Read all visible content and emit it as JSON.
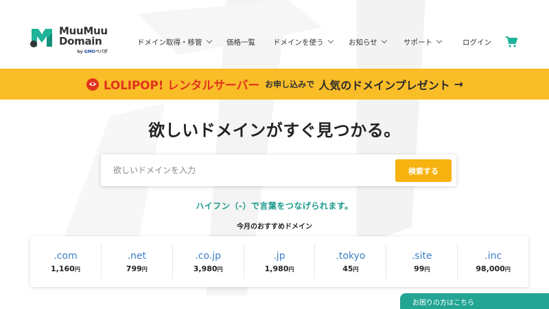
{
  "logo": {
    "line1": "MuuMuu",
    "line2": "Domain",
    "by_text": "by",
    "by_brand": "GMO",
    "by_suffix": "ペパボ"
  },
  "nav": {
    "items": [
      {
        "label": "ドメイン取得・移管",
        "has_dropdown": true
      },
      {
        "label": "価格一覧",
        "has_dropdown": false
      },
      {
        "label": "ドメインを使う",
        "has_dropdown": true
      },
      {
        "label": "お知らせ",
        "has_dropdown": true
      },
      {
        "label": "サポート",
        "has_dropdown": true
      },
      {
        "label": "ログイン",
        "has_dropdown": false
      }
    ],
    "cart_icon": "cart-icon"
  },
  "banner": {
    "brand": "LOLIPOP! レンタルサーバー",
    "middle": "お申し込みで",
    "highlight": "人気のドメインプレゼント",
    "arrow": "→"
  },
  "hero": {
    "title": "欲しいドメインがすぐ見つかる。"
  },
  "search": {
    "placeholder": "欲しいドメインを入力",
    "value": "",
    "button_label": "検索する"
  },
  "hint": "ハイフン（-）で言葉をつなげられます。",
  "recommend": {
    "title": "今月のおすすめドメイン",
    "items": [
      {
        "tld": ".com",
        "price": "1,160",
        "unit": "円"
      },
      {
        "tld": ".net",
        "price": "799",
        "unit": "円"
      },
      {
        "tld": ".co.jp",
        "price": "3,980",
        "unit": "円"
      },
      {
        "tld": ".jp",
        "price": "1,980",
        "unit": "円"
      },
      {
        "tld": ".tokyo",
        "price": "45",
        "unit": "円"
      },
      {
        "tld": ".site",
        "price": "99",
        "unit": "円"
      },
      {
        "tld": ".inc",
        "price": "98,000",
        "unit": "円"
      }
    ]
  },
  "help": {
    "label": "お困りの方はこちら"
  },
  "colors": {
    "banner_bg": "#f9bd28",
    "accent_teal": "#23a594",
    "search_button": "#f6b20f",
    "tld_blue": "#3b7fc4",
    "lolipop_red": "#e2341d"
  }
}
